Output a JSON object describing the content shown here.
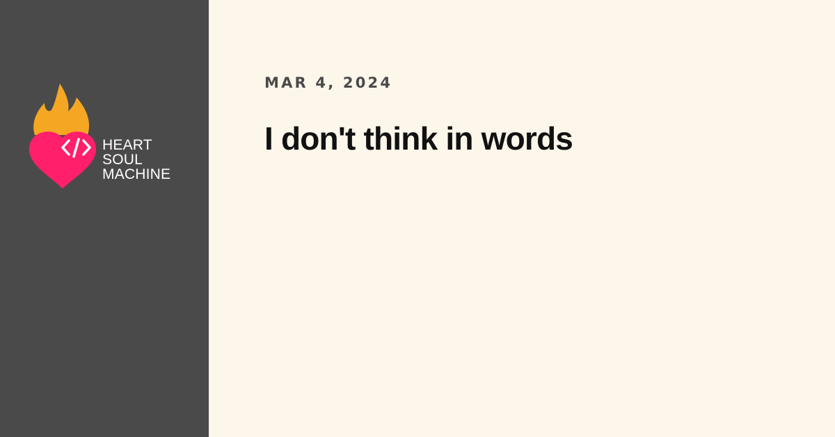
{
  "brand": {
    "line1": "HEART",
    "line2": "SOUL",
    "line3": "MACHINE",
    "logo_icon": "flaming-heart-code-icon",
    "colors": {
      "flame": "#f5a623",
      "heart": "#ff1f6b",
      "text": "#ffffff"
    }
  },
  "post": {
    "date": "MAR 4, 2024",
    "title": "I don't think in words"
  },
  "colors": {
    "sidebar_bg": "#4a4a4a",
    "main_bg": "#fdf6ea",
    "date_text": "#4a4a4a",
    "title_text": "#111111"
  }
}
